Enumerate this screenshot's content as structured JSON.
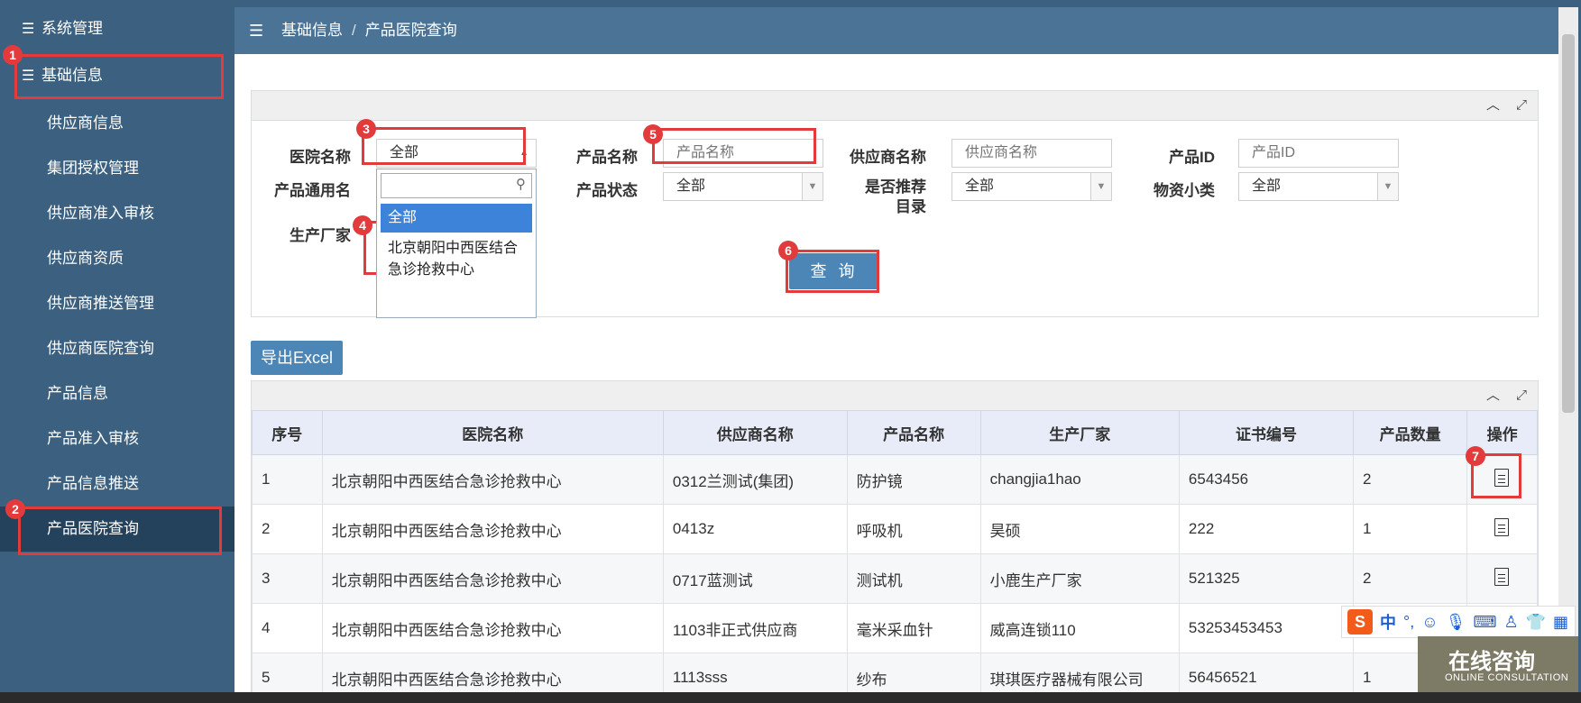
{
  "sidebar": {
    "groups": [
      {
        "label": "系统管理"
      },
      {
        "label": "基础信息"
      }
    ],
    "items": [
      {
        "label": "供应商信息"
      },
      {
        "label": "集团授权管理"
      },
      {
        "label": "供应商准入审核"
      },
      {
        "label": "供应商资质"
      },
      {
        "label": "供应商推送管理"
      },
      {
        "label": "供应商医院查询"
      },
      {
        "label": "产品信息"
      },
      {
        "label": "产品准入审核"
      },
      {
        "label": "产品信息推送"
      },
      {
        "label": "产品医院查询"
      }
    ]
  },
  "breadcrumb": {
    "parent": "基础信息",
    "separator": "/",
    "current": "产品医院查询"
  },
  "search_form": {
    "hospital_label": "医院名称",
    "hospital_value": "全部",
    "product_name_label": "产品名称",
    "product_name_placeholder": "产品名称",
    "supplier_name_label": "供应商名称",
    "supplier_name_placeholder": "供应商名称",
    "product_id_label": "产品ID",
    "product_id_placeholder": "产品ID",
    "generic_name_label": "产品通用名",
    "product_status_label": "产品状态",
    "product_status_value": "全部",
    "recommended_label_1": "是否推荐",
    "recommended_label_2": "目录",
    "recommended_value": "全部",
    "category_label": "物资小类",
    "category_value": "全部",
    "manufacturer_label": "生产厂家",
    "query_button": "查 询"
  },
  "hospital_dropdown": {
    "options": [
      "全部",
      "北京朝阳中西医结合急诊抢救中心"
    ],
    "option_line1": "北京朝阳中西医结合",
    "option_line2": "急诊抢救中心"
  },
  "export_button": "导出Excel",
  "table": {
    "columns": [
      "序号",
      "医院名称",
      "供应商名称",
      "产品名称",
      "生产厂家",
      "证书编号",
      "产品数量",
      "操作"
    ],
    "rows": [
      {
        "no": "1",
        "hospital": "北京朝阳中西医结合急诊抢救中心",
        "supplier": "0312兰测试(集团)",
        "product": "防护镜",
        "manufacturer": "changjia1hao",
        "cert": "6543456",
        "qty": "2"
      },
      {
        "no": "2",
        "hospital": "北京朝阳中西医结合急诊抢救中心",
        "supplier": "0413z",
        "product": "呼吸机",
        "manufacturer": "昊硕",
        "cert": "222",
        "qty": "1"
      },
      {
        "no": "3",
        "hospital": "北京朝阳中西医结合急诊抢救中心",
        "supplier": "0717蓝测试",
        "product": "测试机",
        "manufacturer": "小鹿生产厂家",
        "cert": "521325",
        "qty": "2"
      },
      {
        "no": "4",
        "hospital": "北京朝阳中西医结合急诊抢救中心",
        "supplier": "1103非正式供应商",
        "product": "毫米采血针",
        "manufacturer": "威高连锁110",
        "cert": "53253453453",
        "qty": ""
      },
      {
        "no": "5",
        "hospital": "北京朝阳中西医结合急诊抢救中心",
        "supplier": "1113sss",
        "product": "纱布",
        "manufacturer": "琪琪医疗器械有限公司",
        "cert": "56456521",
        "qty": "1"
      }
    ]
  },
  "annotations": [
    "1",
    "2",
    "3",
    "4",
    "5",
    "6",
    "7"
  ],
  "ime": {
    "mode": "中",
    "punct": "°,"
  },
  "consult": {
    "title": "在线咨询",
    "subtitle": "ONLINE CONSULTATION"
  },
  "colors": {
    "sidebar": "#3c6180",
    "topbar": "#4b7396",
    "highlight": "#e33b3b",
    "button": "#4b86b6"
  }
}
